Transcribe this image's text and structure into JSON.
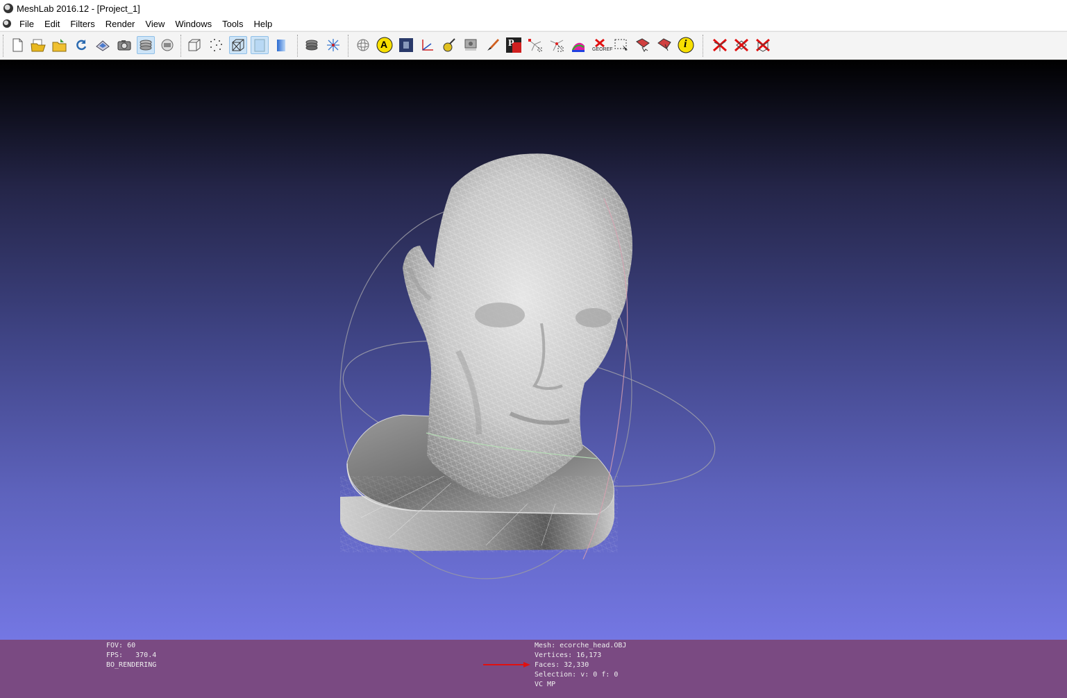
{
  "window": {
    "title": "MeshLab 2016.12 - [Project_1]"
  },
  "menu": [
    "File",
    "Edit",
    "Filters",
    "Render",
    "View",
    "Windows",
    "Tools",
    "Help"
  ],
  "toolbar": {
    "buttons": [
      {
        "name": "new-project-icon"
      },
      {
        "name": "open-project-icon"
      },
      {
        "name": "import-mesh-icon"
      },
      {
        "name": "reload-icon"
      },
      {
        "name": "export-mesh-icon"
      },
      {
        "name": "snapshot-icon"
      },
      {
        "name": "layer-dialog-icon",
        "active": true
      },
      {
        "name": "raster-icon"
      },
      {
        "name": "bbox-icon"
      },
      {
        "name": "points-icon"
      },
      {
        "name": "wireframe-icon",
        "active": true
      },
      {
        "name": "flat-icon",
        "active": true
      },
      {
        "name": "smooth-icon"
      },
      {
        "name": "lighting-icon"
      },
      {
        "name": "trackball-icon"
      },
      {
        "name": "sphere-icon"
      },
      {
        "name": "annotation-icon",
        "label": "A"
      },
      {
        "name": "texture-icon"
      },
      {
        "name": "measure-icon"
      },
      {
        "name": "paint-icon"
      },
      {
        "name": "raster-align-icon"
      },
      {
        "name": "paintbrush-icon"
      },
      {
        "name": "pp-icon",
        "label": "P"
      },
      {
        "name": "select-vertices-icon"
      },
      {
        "name": "select-connected-icon"
      },
      {
        "name": "colorize-icon"
      },
      {
        "name": "georef-icon",
        "label": "GEOREF"
      },
      {
        "name": "select-faces-icon"
      },
      {
        "name": "select-border-icon"
      },
      {
        "name": "select-region-icon"
      },
      {
        "name": "info-icon",
        "label": "i"
      },
      {
        "name": "delete-vertices-icon"
      },
      {
        "name": "delete-faces-icon"
      },
      {
        "name": "delete-selection-icon"
      }
    ]
  },
  "info": {
    "left": [
      "FOV: 60",
      "FPS:   370.4",
      "BO_RENDERING"
    ],
    "right": [
      "Mesh: ecorche_head.OBJ",
      "Vertices: 16,173",
      "Faces: 32,330",
      "Selection: v: 0 f: 0",
      "VC MP"
    ]
  },
  "colors": {
    "info_bar": "#7a4a82",
    "arrow": "#e01010",
    "active_tool": "#cde4f7"
  }
}
